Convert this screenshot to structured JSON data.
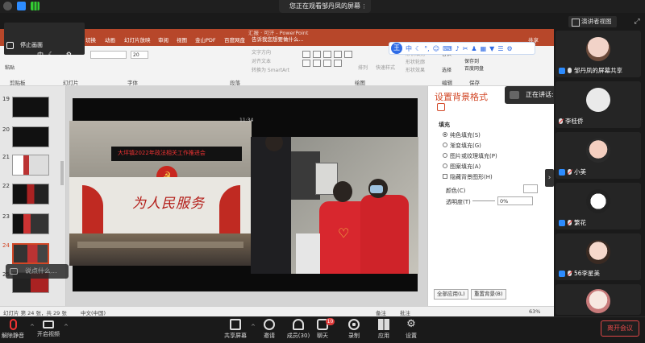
{
  "topbar": {
    "share_banner": "您正在观看邹丹凤的屏幕",
    "view_button": "演讲者视图"
  },
  "ppt": {
    "tabs": [
      "切换",
      "动画",
      "幻灯片放映",
      "审阅",
      "视图",
      "金山PDF",
      "百度网盘"
    ],
    "tell_me": "告诉我您想要做什么...",
    "doc_title": "汇报 · 可汗 - PowerPoint",
    "share": "共享",
    "group_labels": [
      "剪贴板",
      "幻灯片",
      "字体",
      "段落",
      "绘图",
      "编辑",
      "保存"
    ],
    "font_size": "20",
    "ribbon_texts": {
      "text_direction": "文字方向",
      "align_text": "对齐文本",
      "smartart": "转换为 SmartArt",
      "arrange": "排列",
      "quick_styles": "快速样式",
      "shape_fill": "形状填充",
      "shape_outline": "形状轮廓",
      "shape_effects": "形状效果",
      "replace": "替换",
      "select": "选择",
      "save_to": "保存到",
      "baidu": "百度网盘",
      "paste": "粘贴"
    },
    "thumb_numbers": [
      "19",
      "20",
      "21",
      "22",
      "23",
      "24",
      "25",
      "26"
    ],
    "status": {
      "slide_info": "幻灯片 第 24 张，共 29 张",
      "lang": "中文(中国)",
      "notes": "备注",
      "comments": "批注",
      "zoom": "63%"
    }
  },
  "slide": {
    "banner_text": "大坪镇2022年政法相关工作推进会",
    "wall_text": "为人民服务",
    "clock": "11:34"
  },
  "annotation": {
    "title": "停止画面",
    "ime_logo": "王",
    "ime_mode": "中"
  },
  "format_pane": {
    "title": "设置背景格式",
    "section": "填充",
    "options": [
      "纯色填充(S)",
      "渐变填充(G)",
      "图片或纹理填充(P)",
      "图案填充(A)"
    ],
    "hide_graphics": "隐藏背景图形(H)",
    "color_label": "颜色(C)",
    "transparency_label": "透明度(T)",
    "transparency_value": "0%",
    "apply_all": "全部应用(L)",
    "reset": "重置背景(B)"
  },
  "speaking": {
    "left": "说点什么...",
    "right": "正在讲话: 邹丹凤;"
  },
  "gallery": {
    "tiles": [
      {
        "name": "邹丹凤的屏幕共享"
      },
      {
        "name": "李桂侨"
      },
      {
        "name": "小美"
      },
      {
        "name": "繁花"
      },
      {
        "name": "56李星美"
      },
      {
        "name": ""
      }
    ]
  },
  "toolbar": {
    "mute": "解除静音",
    "video": "开启视频",
    "share_screen": "共享屏幕",
    "invite": "邀请",
    "members": "成员(30)",
    "chat": "聊天",
    "chat_badge": "10",
    "record": "录制",
    "apps": "应用",
    "settings": "设置",
    "end": "离开会议"
  }
}
